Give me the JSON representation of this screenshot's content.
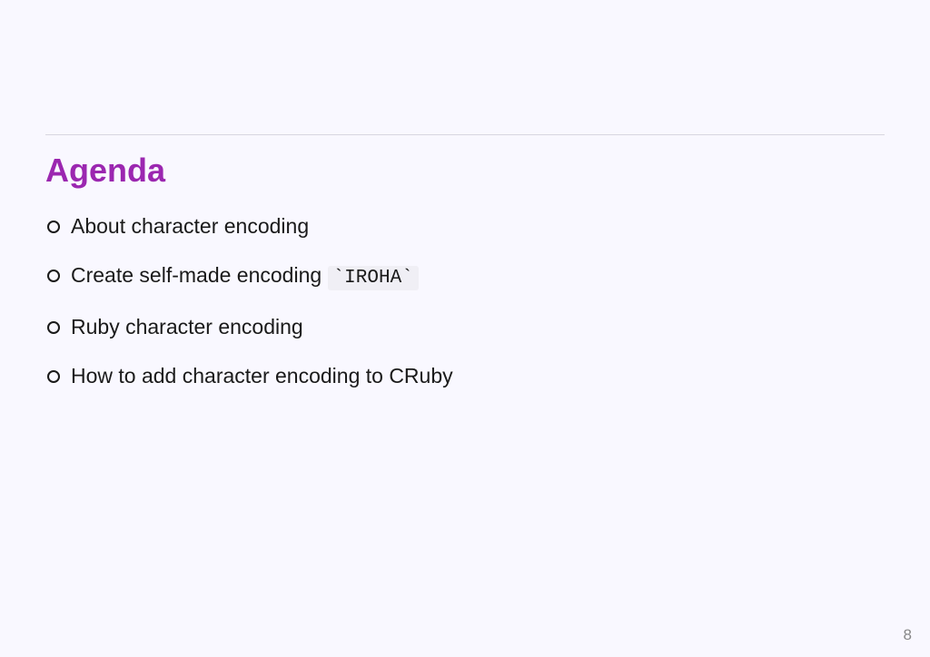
{
  "heading": "Agenda",
  "items": [
    {
      "text": "About character encoding"
    },
    {
      "text": "Create self-made encoding ",
      "code": "`IROHA`"
    },
    {
      "text": "Ruby character encoding"
    },
    {
      "text": "How to add character encoding to CRuby"
    }
  ],
  "pageNumber": "8"
}
